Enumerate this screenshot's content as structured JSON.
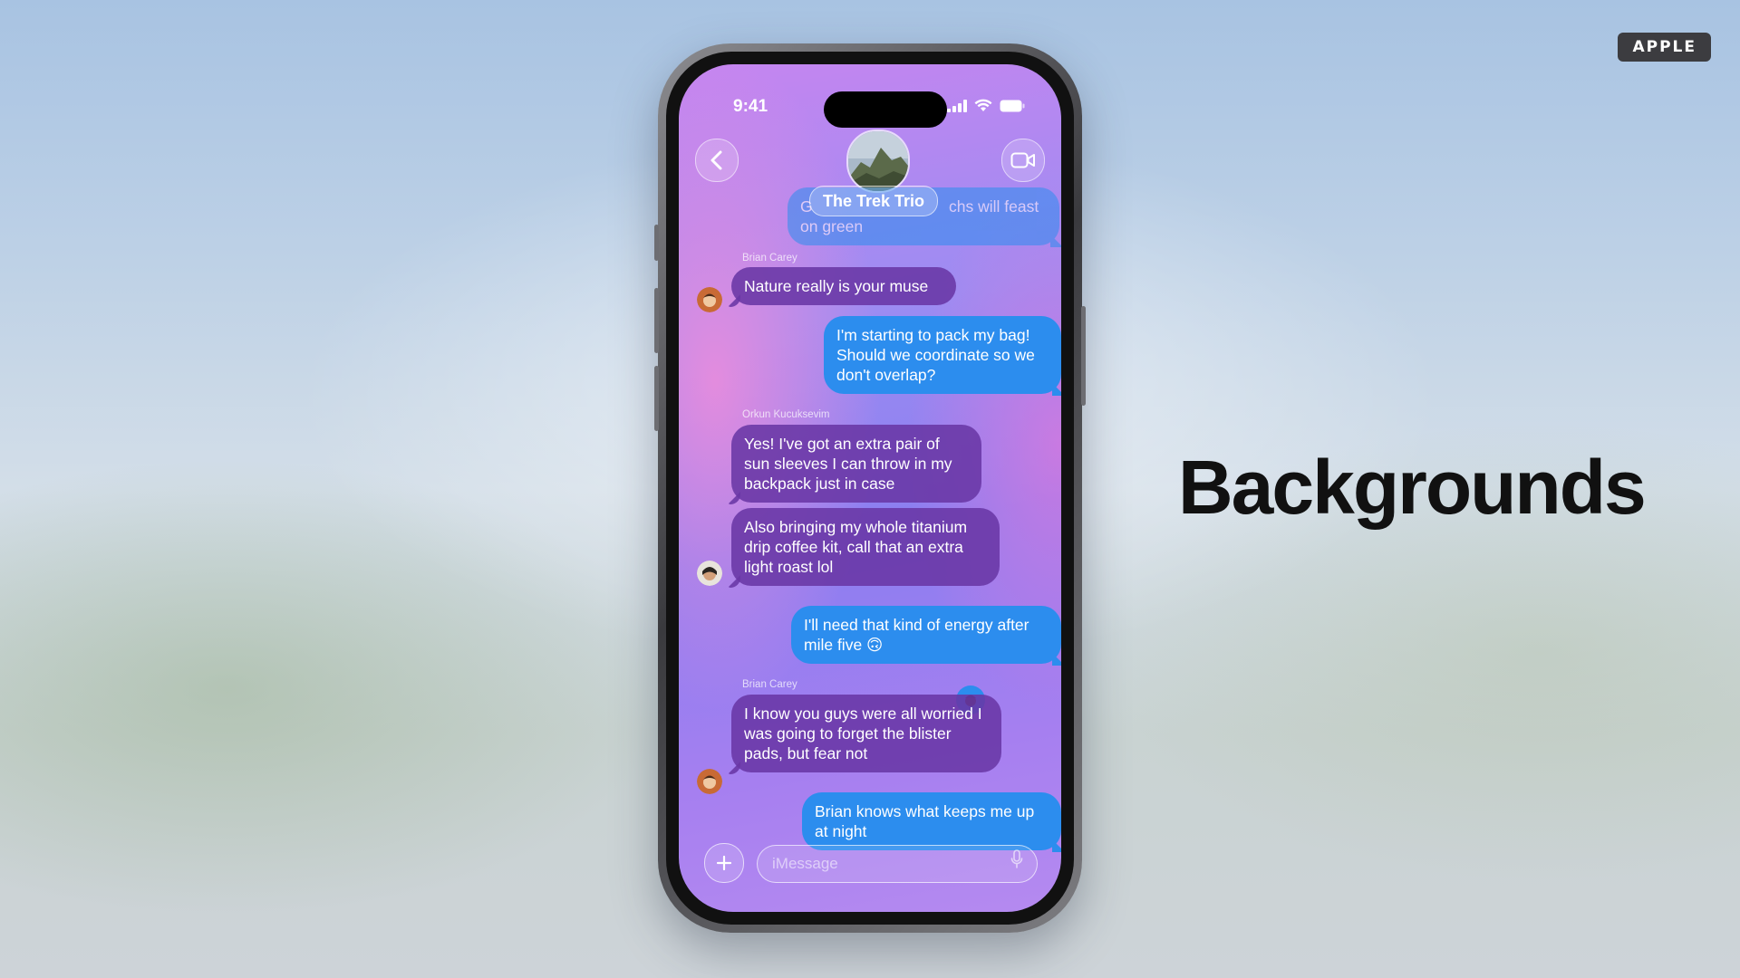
{
  "brand_badge": "APPLE",
  "slide_title": "Backgrounds",
  "status_bar": {
    "time": "9:41"
  },
  "conversation": {
    "group_name": "The Trek Trio",
    "partial_message": {
      "text_visible": "on green",
      "text_fragment": "chs will feast",
      "text_lead": "G"
    },
    "messages": [
      {
        "sender": "Brian Carey",
        "text": "Nature really is your muse"
      },
      {
        "text": "I'm starting to pack my bag! Should we coordinate so we don't overlap?"
      },
      {
        "sender": "Orkun Kucuksevim",
        "text": "Yes! I've got an extra pair of sun sleeves I can throw in my backpack just in case"
      },
      {
        "text": "Also bringing my whole titanium drip coffee kit, call that an extra light roast lol"
      },
      {
        "text": "I'll need that kind of energy after mile five 🙃"
      },
      {
        "sender": "Brian Carey",
        "text": "I know you guys were all worried I was going to forget the blister pads, but fear not"
      },
      {
        "text": "Brian knows what keeps me up at night"
      }
    ]
  },
  "composer": {
    "placeholder": "iMessage"
  }
}
